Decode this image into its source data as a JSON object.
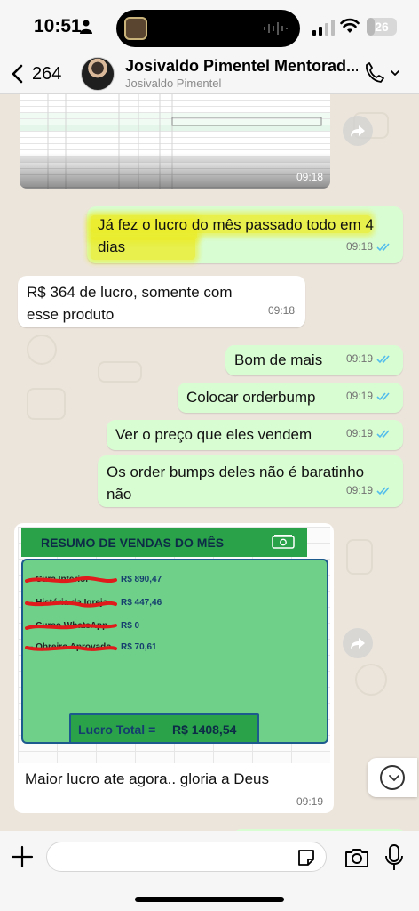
{
  "status_bar": {
    "time": "10:51",
    "battery": "26",
    "battery_level_percent": 26
  },
  "header": {
    "back_count": "264",
    "contact_name": "Josivaldo Pimentel Mentorad...",
    "contact_subtitle": "Josivaldo Pimentel"
  },
  "messages": {
    "image1_time": "09:18",
    "m1": {
      "text": "Já fez o lucro do mês passado todo em 4 dias",
      "time": "09:18",
      "highlighted": true
    },
    "m2": {
      "text": "R$ 364 de lucro, somente com esse produto",
      "time": "09:18"
    },
    "m3": {
      "text": "Bom de mais",
      "time": "09:19"
    },
    "m4": {
      "text": "Colocar orderbump",
      "time": "09:19"
    },
    "m5": {
      "text": "Ver o preço que eles vendem",
      "time": "09:19"
    },
    "m6": {
      "text": "Os order bumps deles não é baratinho não",
      "time": "09:19"
    },
    "sales": {
      "title": "RESUMO DE VENDAS DO MÊS",
      "rows": [
        {
          "label": "- Cura Interior",
          "value": "R$  890,47"
        },
        {
          "label": "- História da Igreja",
          "value": "R$  447,46"
        },
        {
          "label": "- Curso WhatsApp",
          "value": "R$  0"
        },
        {
          "label": "- Obreiro Aprovado",
          "value": "R$  70,61"
        }
      ],
      "total_label": "Lucro Total =",
      "total_value": "R$  1408,54",
      "caption": "Maior lucro ate agora.. gloria a Deus",
      "time": "09:19"
    }
  },
  "input": {
    "placeholder": ""
  },
  "colors": {
    "outgoing_bubble": "#d9fdd3",
    "incoming_bubble": "#ffffff",
    "read_ticks": "#53bdeb",
    "highlight": "#ebec28"
  },
  "icons": {
    "back": "chevron-left-icon",
    "call": "phone-icon",
    "forward": "forward-icon",
    "scroll_down": "chevron-down-icon",
    "plus": "plus-icon",
    "sticker": "sticker-icon",
    "camera": "camera-icon",
    "mic": "microphone-icon"
  }
}
